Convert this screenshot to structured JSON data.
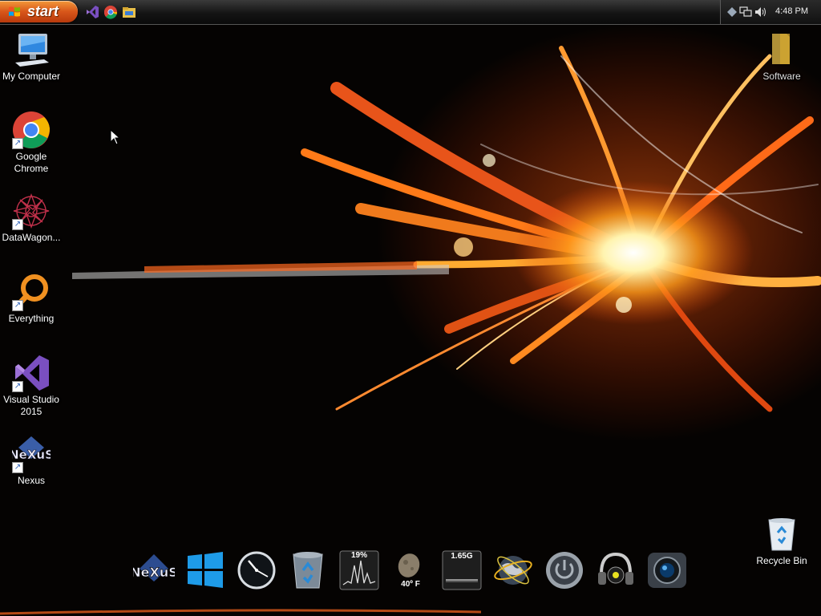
{
  "taskbar": {
    "start_label": "start",
    "quick_launch": [
      {
        "name": "visual-studio-icon"
      },
      {
        "name": "chrome-icon"
      },
      {
        "name": "explorer-folder-icon"
      }
    ],
    "tray": {
      "icons": [
        "tray-diamond-icon",
        "network-icon",
        "volume-icon"
      ],
      "time": "4:48 PM"
    }
  },
  "desktop": {
    "left_icons": [
      {
        "label": "My Computer",
        "icon": "computer-icon"
      },
      {
        "label": "Google Chrome",
        "icon": "chrome-icon"
      },
      {
        "label": "DataWagon...",
        "icon": "datawagon-icon"
      },
      {
        "label": "Everything",
        "icon": "everything-icon"
      },
      {
        "label": "Visual Studio 2015",
        "icon": "visual-studio-icon"
      },
      {
        "label": "Nexus",
        "icon": "nexus-icon"
      }
    ],
    "right_icons": [
      {
        "label": "Software",
        "icon": "folder-icon"
      },
      {
        "label": "Recycle Bin",
        "icon": "recycle-bin-icon"
      }
    ]
  },
  "dock": {
    "items": [
      {
        "name": "nexus-dock-icon"
      },
      {
        "name": "windows-dock-icon"
      },
      {
        "name": "clock-dock-icon"
      },
      {
        "name": "recycle-dock-icon"
      },
      {
        "name": "cpu-meter-dock-icon",
        "text": "19%"
      },
      {
        "name": "weather-dock-icon",
        "text": "40º F"
      },
      {
        "name": "memory-meter-dock-icon",
        "text": "1.65G"
      },
      {
        "name": "network-globe-dock-icon"
      },
      {
        "name": "power-dock-icon"
      },
      {
        "name": "music-dock-icon"
      },
      {
        "name": "camera-dock-icon"
      }
    ]
  },
  "colors": {
    "accent": "#e8651e",
    "fire_core": "#fff6c8",
    "fire_mid": "#ff9a1a",
    "fire_outer": "#d63d0a"
  }
}
